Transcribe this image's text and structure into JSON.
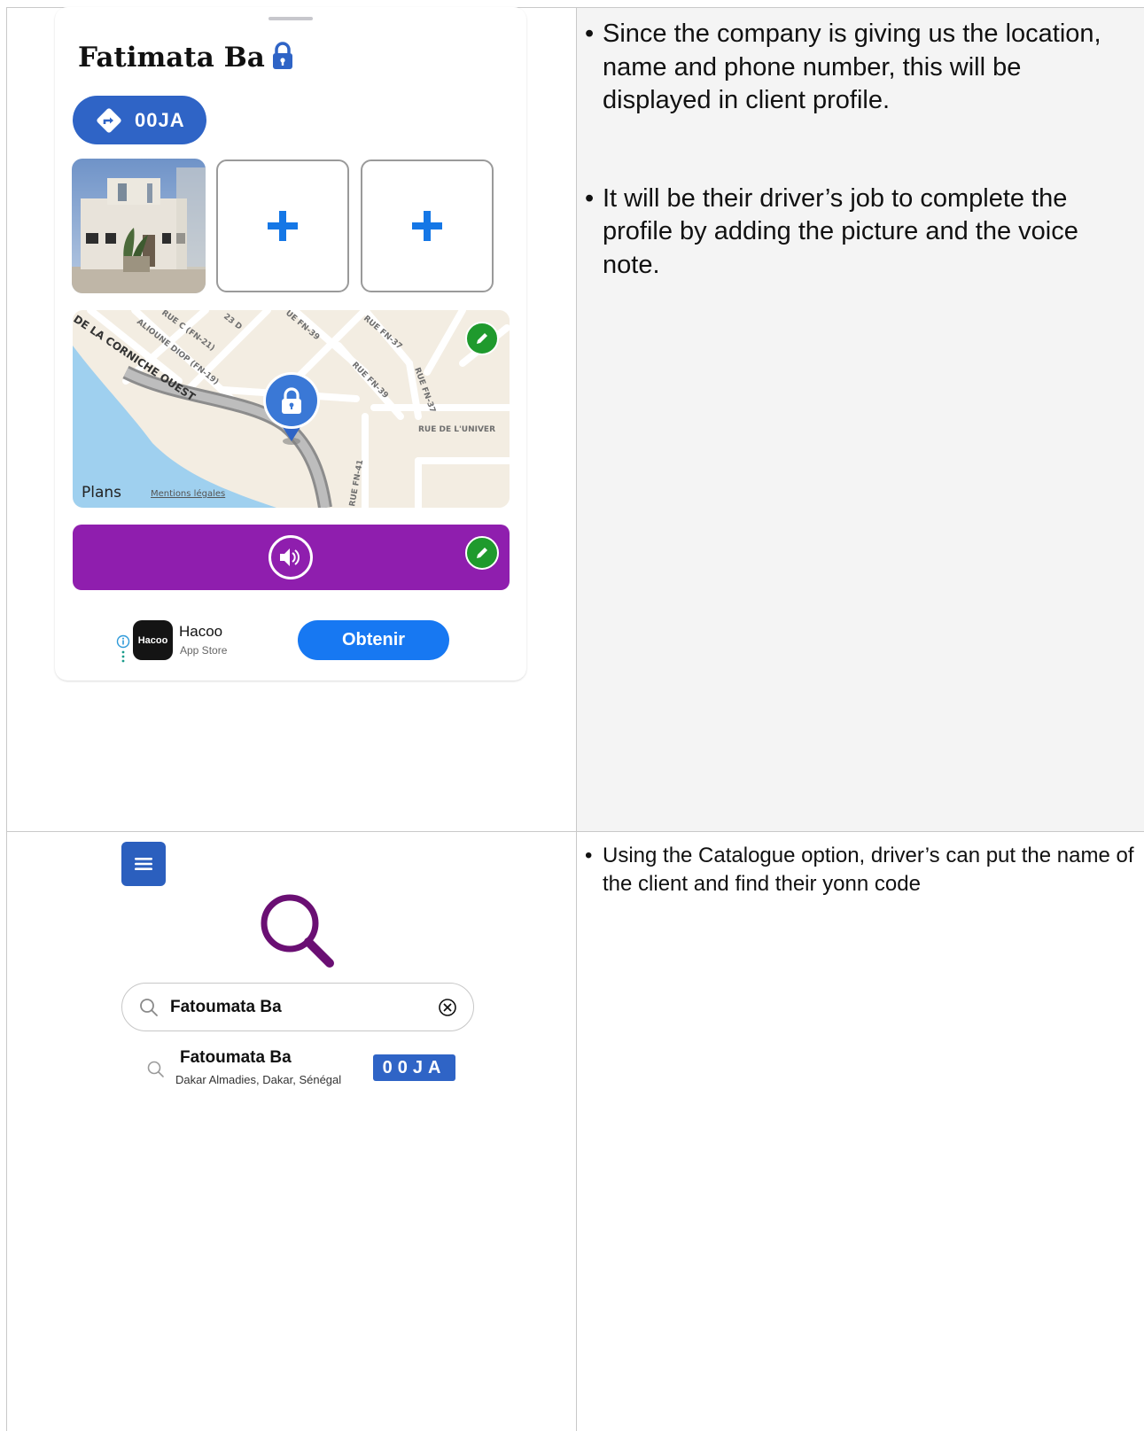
{
  "notes": {
    "top": [
      "Since the company is giving us the location, name and phone number, this will be displayed in client profile.",
      "It will be their driver’s job to complete the profile by adding  the picture and the voice note."
    ],
    "bottom": [
      "Using the Catalogue option, driver’s can put the name of the client and find their yonn code"
    ]
  },
  "profile": {
    "name": "Fatimata Ba",
    "code": "00JA",
    "lock_icon": "lock-icon",
    "add_photo_icon": "plus-icon"
  },
  "map": {
    "streets": [
      "DE LA CORNICHE OUEST",
      "ALIOUNE DIOP (FN-19)",
      "RUE C (FN-21)",
      "23 D",
      "UE FN-39",
      "RUE FN-37",
      "RUE FN-39",
      "RUE FN-37",
      "RUE DE L'UNIVER",
      "RUE FN-41"
    ],
    "brand": "Plans",
    "legal": "Mentions légales"
  },
  "ad": {
    "app_icon_label": "Hacoo",
    "title": "Hacoo",
    "subtitle": "App Store",
    "button": "Obtenir"
  },
  "catalogue": {
    "search_value": "Fatoumata Ba",
    "result": {
      "name": "Fatoumata Ba",
      "address": "Dakar Almadies, Dakar, Sénégal",
      "code": "00JA"
    }
  },
  "colors": {
    "brand_blue": "#2f64c6",
    "voice_purple": "#8f1eae",
    "edit_green": "#1f9a2d",
    "search_purple": "#6a0f73"
  }
}
